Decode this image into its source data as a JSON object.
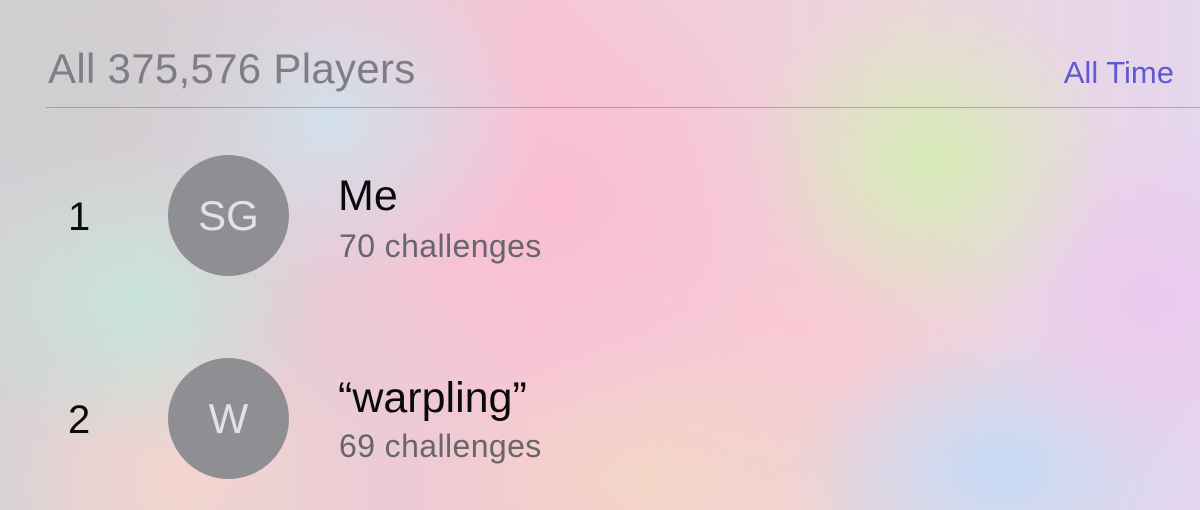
{
  "header": {
    "title": "All 375,576 Players",
    "filter_label": "All Time"
  },
  "players": [
    {
      "rank": "1",
      "initials": "SG",
      "name": "Me",
      "subtitle": "70 challenges"
    },
    {
      "rank": "2",
      "initials": "W",
      "name": "“warpling”",
      "subtitle": "69 challenges"
    }
  ],
  "colors": {
    "accent": "#5d5ad3",
    "avatar": "#8f8e93",
    "title_gray": "#7f7e84",
    "subtitle_gray": "#67666b"
  }
}
